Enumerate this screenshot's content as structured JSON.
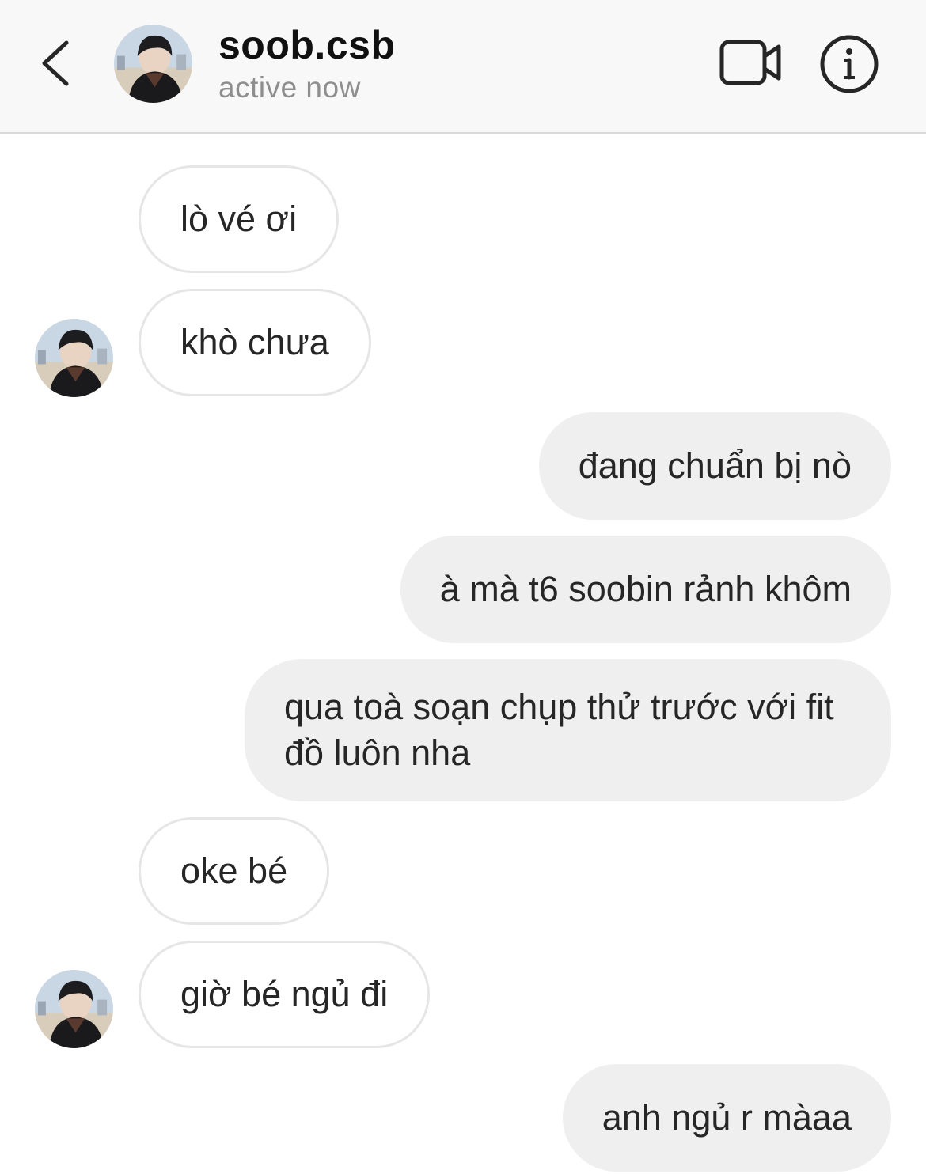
{
  "header": {
    "username": "soob.csb",
    "status": "active now",
    "icons": [
      "back-chevron-icon",
      "video-camera-icon",
      "info-icon"
    ]
  },
  "messages": [
    {
      "sender": "them",
      "text": "lò vé ơi"
    },
    {
      "sender": "them",
      "text": "khò chưa"
    },
    {
      "sender": "me",
      "text": "đang chuẩn bị nò"
    },
    {
      "sender": "me",
      "text": "à mà t6 soobin rảnh khôm"
    },
    {
      "sender": "me",
      "text": "qua toà soạn chụp thử trước với fit đồ luôn nha"
    },
    {
      "sender": "them",
      "text": "oke bé"
    },
    {
      "sender": "them",
      "text": "giờ bé ngủ đi"
    },
    {
      "sender": "me",
      "text": "anh ngủ r màaa"
    }
  ],
  "colors": {
    "header_bg": "#f8f8f8",
    "incoming_border": "#e6e6e6",
    "outgoing_bg": "#efefef",
    "text": "#262626",
    "muted": "#8e8e8e"
  }
}
